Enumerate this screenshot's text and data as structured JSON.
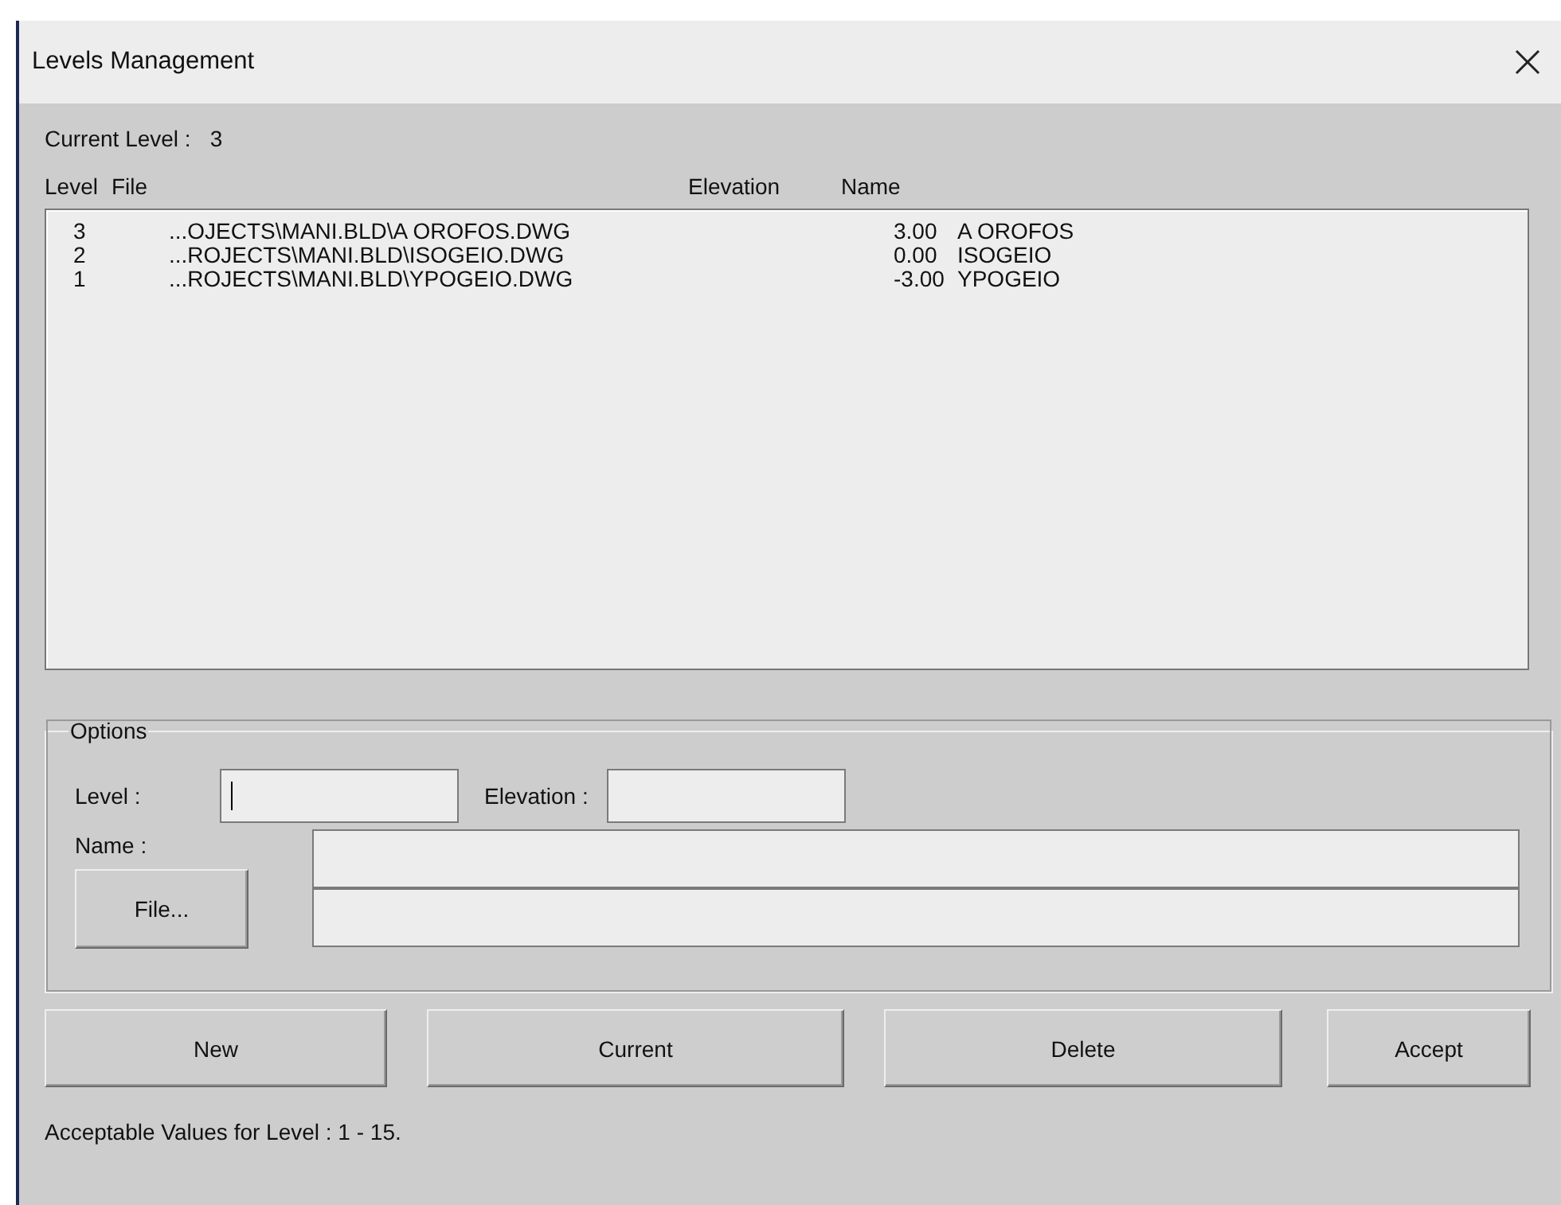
{
  "window": {
    "title": "Levels Management"
  },
  "current_level": {
    "label": "Current Level :",
    "value": "3"
  },
  "list": {
    "columns": [
      "Level",
      "File",
      "Elevation",
      "Name"
    ],
    "rows": [
      {
        "level": "3",
        "file": "...OJECTS\\MANI.BLD\\A OROFOS.DWG",
        "elevation": "3.00",
        "name": "A OROFOS"
      },
      {
        "level": "2",
        "file": "...ROJECTS\\MANI.BLD\\ISOGEIO.DWG",
        "elevation": "0.00",
        "name": "ISOGEIO"
      },
      {
        "level": "1",
        "file": "...ROJECTS\\MANI.BLD\\YPOGEIO.DWG",
        "elevation": "-3.00",
        "name": "YPOGEIO"
      }
    ]
  },
  "options": {
    "title": "Options",
    "level_label": "Level :",
    "level_focused": true,
    "elevation_label": "Elevation :",
    "name_label": "Name :",
    "file_button": "File..."
  },
  "buttons": [
    "New",
    "Current",
    "Delete",
    "Accept"
  ],
  "status": "Acceptable Values for Level : 1 - 15."
}
